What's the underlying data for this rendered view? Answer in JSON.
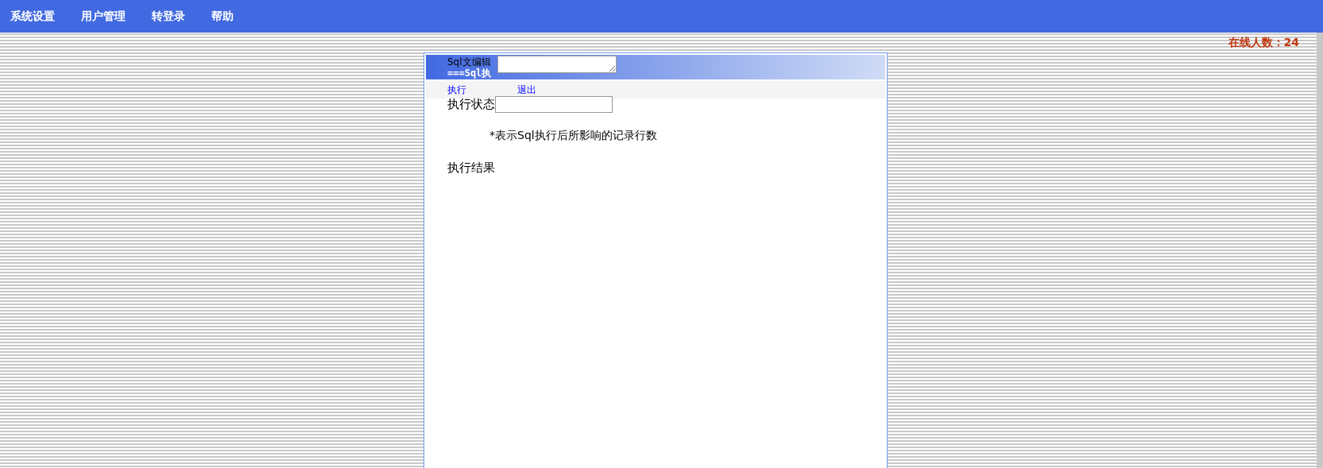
{
  "menu": [
    {
      "label": "系统设置"
    },
    {
      "label": "用户管理"
    },
    {
      "label": "转登录"
    },
    {
      "label": "帮助"
    }
  ],
  "online": "在线人数：24",
  "panel": {
    "editor_label": "Sql文编辑",
    "title": "===Sql执",
    "actions": [
      "执行",
      "退出"
    ],
    "status_label": "执行状态",
    "note": "*表示Sql执行后所影响的记录行数",
    "result_label": "执行结果"
  }
}
